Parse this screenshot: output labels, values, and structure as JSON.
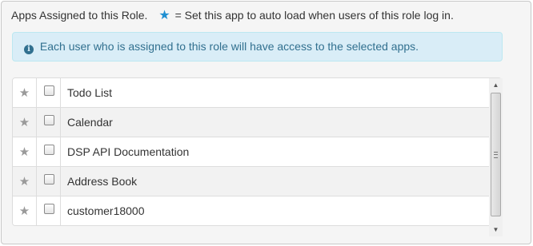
{
  "heading": {
    "text": "Apps Assigned to this Role.",
    "legend_icon": "star-icon",
    "legend_color": "#1f8fd1",
    "legend_text": "= Set this app to auto load when users of this role log in."
  },
  "alert": {
    "icon": "info-icon",
    "icon_glyph": "i",
    "text": "Each user who is assigned to this role will have access to the selected apps."
  },
  "apps": [
    {
      "name": "Todo List"
    },
    {
      "name": "Calendar"
    },
    {
      "name": "DSP API Documentation"
    },
    {
      "name": "Address Book"
    },
    {
      "name": "customer18000"
    }
  ],
  "scrollbar": {
    "up_glyph": "▲",
    "down_glyph": "▼"
  }
}
